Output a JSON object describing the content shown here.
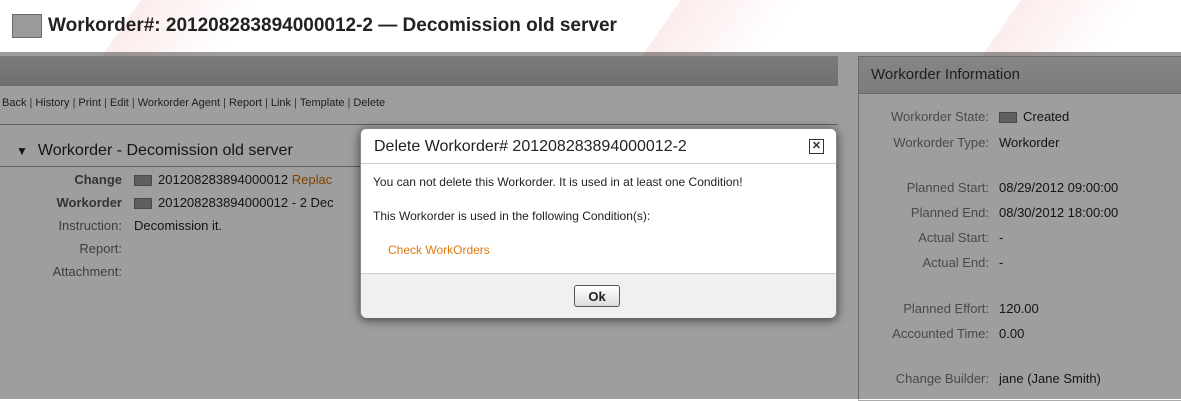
{
  "title": "Workorder#: 201208283894000012-2 — Decomission old server",
  "nav": [
    "Back",
    "History",
    "Print",
    "Edit",
    "Workorder Agent",
    "Report",
    "Link",
    "Template",
    "Delete"
  ],
  "workorder": {
    "heading": "Workorder - Decomission old server",
    "change_label": "Change",
    "change_value": "201208283894000012",
    "change_link": "Replac",
    "workorder_label": "Workorder",
    "workorder_value": "201208283894000012 - 2 Dec",
    "instruction_label": "Instruction:",
    "instruction_value": "Decomission it.",
    "report_label": "Report:",
    "attachment_label": "Attachment:"
  },
  "info": {
    "header": "Workorder Information",
    "rows": [
      {
        "label": "Workorder State:",
        "value": "Created"
      },
      {
        "label": "Workorder Type:",
        "value": "Workorder"
      },
      {
        "label": "Planned Start:",
        "value": "08/29/2012 09:00:00"
      },
      {
        "label": "Planned End:",
        "value": "08/30/2012 18:00:00"
      },
      {
        "label": "Actual Start:",
        "value": "-"
      },
      {
        "label": "Actual End:",
        "value": "-"
      },
      {
        "label": "Planned Effort:",
        "value": "120.00"
      },
      {
        "label": "Accounted Time:",
        "value": "0.00"
      },
      {
        "label": "Change Builder:",
        "value": "jane (Jane Smith)"
      }
    ]
  },
  "dialog": {
    "title": "Delete Workorder# 201208283894000012-2",
    "message1": "You can not delete this Workorder. It is used in at least one Condition!",
    "message2": "This Workorder is used in the following Condition(s):",
    "condition_link": "Check WorkOrders",
    "ok_label": "Ok"
  }
}
